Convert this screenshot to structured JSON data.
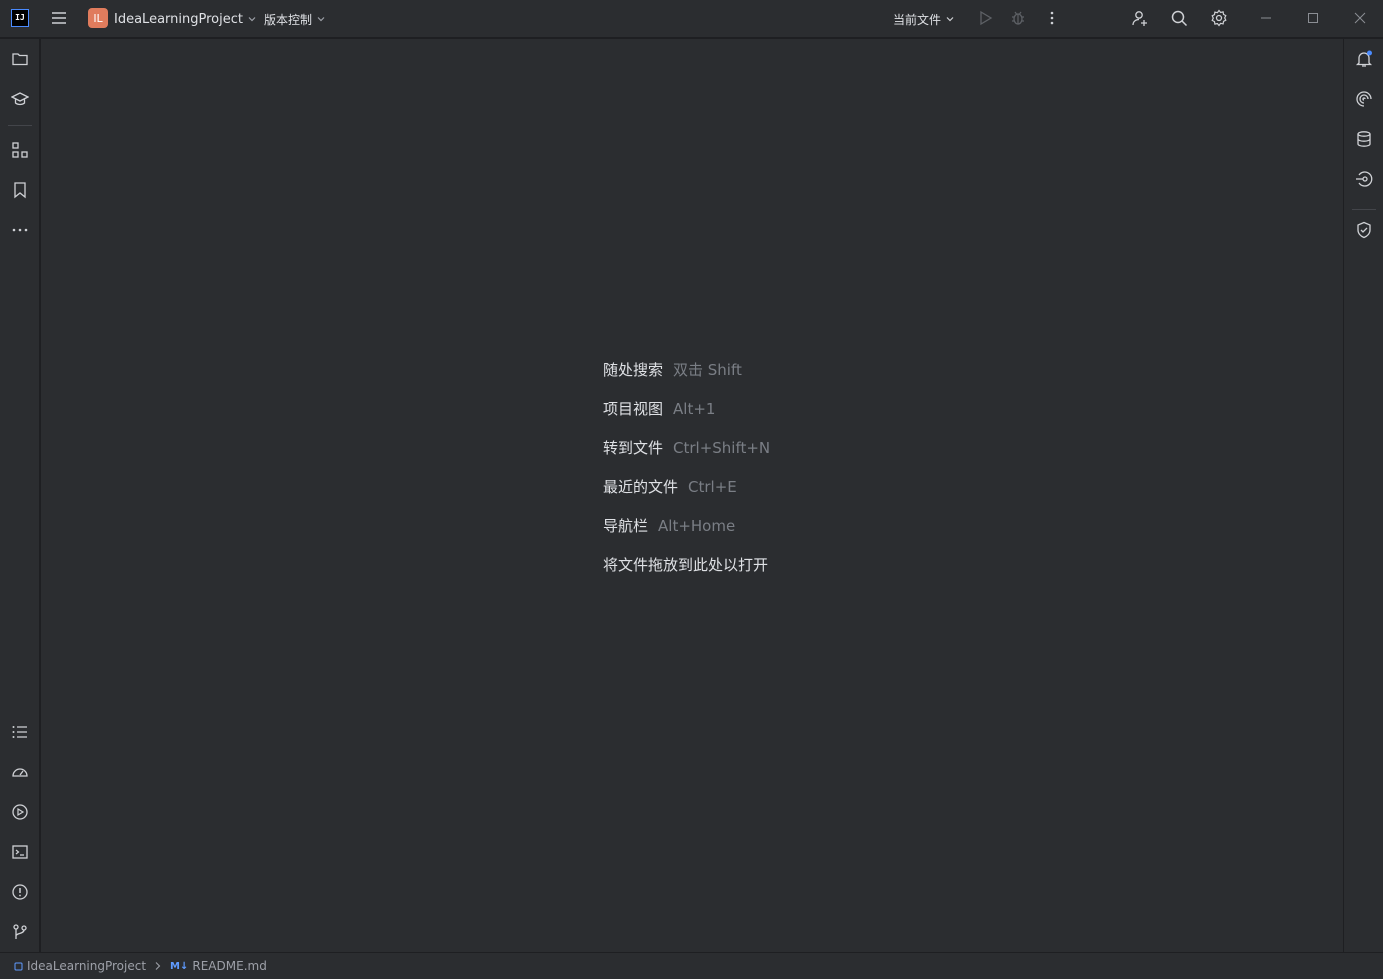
{
  "titlebar": {
    "logo_text": "IJ",
    "project_badge": "IL",
    "project_name": "IdeaLearningProject",
    "vcs_label": "版本控制",
    "run_config": "当前文件"
  },
  "editor": {
    "hints": [
      {
        "label": "随处搜索",
        "key": "双击 Shift"
      },
      {
        "label": "项目视图",
        "key": "Alt+1"
      },
      {
        "label": "转到文件",
        "key": "Ctrl+Shift+N"
      },
      {
        "label": "最近的文件",
        "key": "Ctrl+E"
      },
      {
        "label": "导航栏",
        "key": "Alt+Home"
      },
      {
        "label": "将文件拖放到此处以打开",
        "key": ""
      }
    ]
  },
  "statusbar": {
    "project": "IdeaLearningProject",
    "file_badge": "M↓",
    "file": "README.md"
  },
  "icons": {
    "left_top": [
      "folder-icon",
      "learn-icon",
      "structure-icon",
      "bookmark-icon",
      "more-icon"
    ],
    "left_bottom": [
      "todo-icon",
      "profiler-icon",
      "services-icon",
      "terminal-icon",
      "problems-icon",
      "git-icon"
    ],
    "right": [
      "notifications-icon",
      "ai-assistant-icon",
      "database-icon",
      "endpoints-icon",
      "security-icon"
    ]
  },
  "colors": {
    "accent": "#4a8bff",
    "project_badge": "#e07c5d",
    "notification_dot": "#4a8bff"
  }
}
